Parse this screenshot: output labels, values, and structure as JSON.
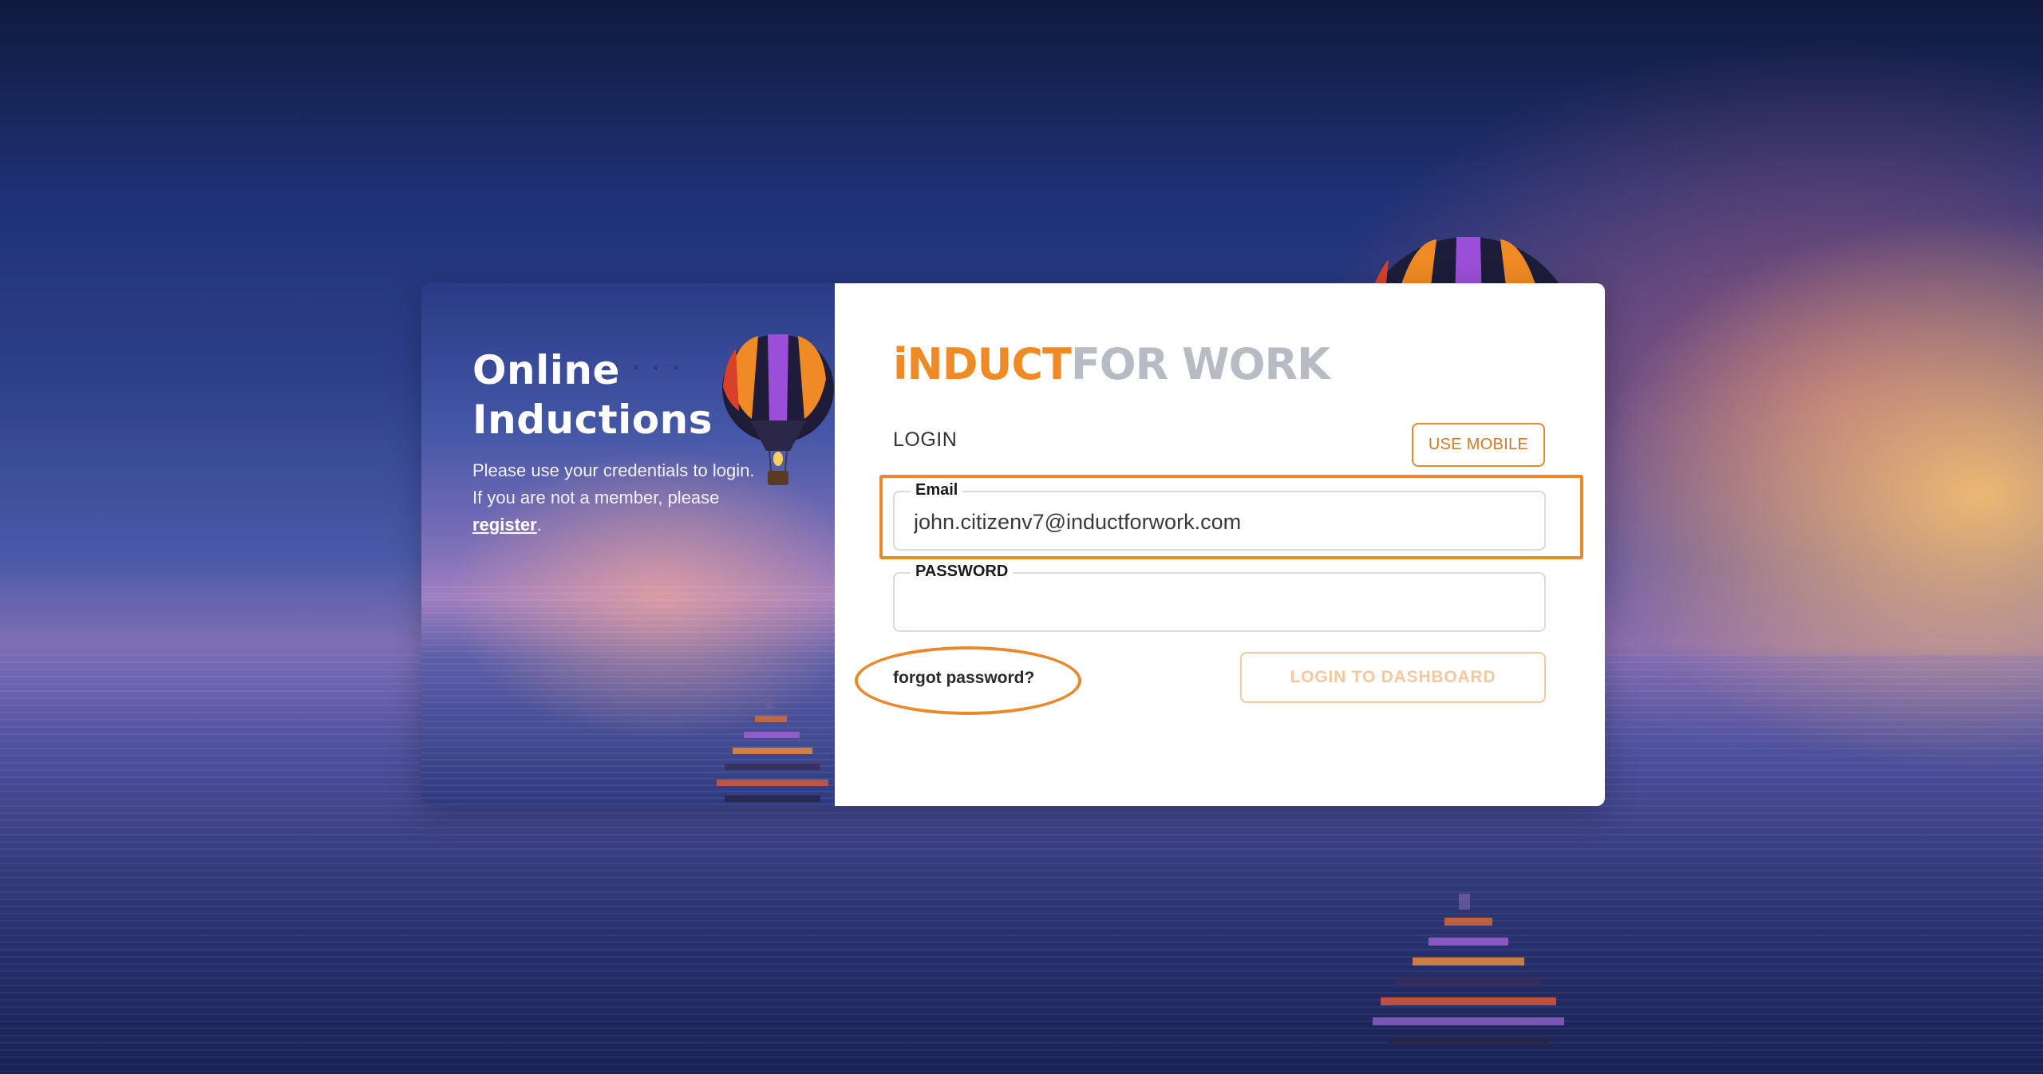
{
  "hero": {
    "title_line1": "Online",
    "title_line2": "Inductions",
    "text_line1": "Please use your credentials to login.",
    "text_line2_prefix": "If you are not a member, please",
    "register_link": "register",
    "text_suffix": "."
  },
  "logo": {
    "part1": "iNDUCT",
    "part2": "FOR WORK"
  },
  "login": {
    "heading": "LOGIN",
    "use_mobile_label": "USE MOBILE",
    "email_label": "Email",
    "email_value": "john.citizenv7@inductforwork.com",
    "password_label": "PASSWORD",
    "password_value": "",
    "forgot_label": "forgot password?",
    "submit_label": "LOGIN TO DASHBOARD"
  },
  "colors": {
    "accent": "#e8892c",
    "logo_gray": "#b7bcc4"
  },
  "icons": {
    "balloon": "hot-air-balloon-icon",
    "birds": "birds-icon"
  }
}
